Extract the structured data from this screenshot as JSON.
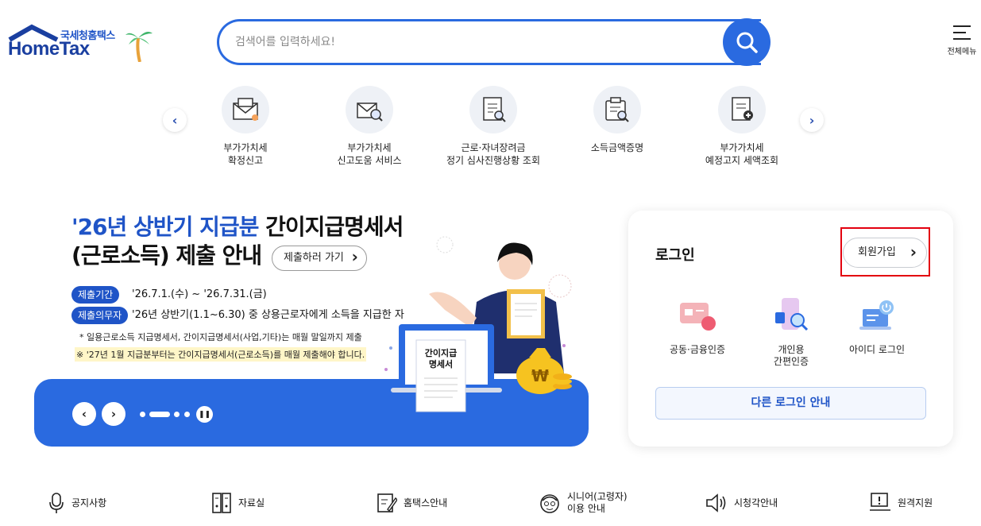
{
  "header": {
    "logo_kr": "국세청홈택스",
    "logo_en": "HomeTax",
    "search_placeholder": "검색어를 입력하세요!",
    "all_menu_label": "전체메뉴"
  },
  "quick_menu": [
    {
      "icon": "tax-envelope-icon",
      "line1": "부가가치세",
      "line2": "확정신고"
    },
    {
      "icon": "tax-search-icon",
      "line1": "부가가치세",
      "line2": "신고도움 서비스"
    },
    {
      "icon": "document-search-icon",
      "line1": "근로·자녀장려금",
      "line2": "정기 심사진행상황 조회"
    },
    {
      "icon": "certificate-search-icon",
      "line1": "소득금액증명",
      "line2": ""
    },
    {
      "icon": "document-add-icon",
      "line1": "부가가치세",
      "line2": "예정고지 세액조회"
    }
  ],
  "banner": {
    "title_hl": "'26년 상반기 지급분",
    "title_rest": " 간이지급명세서",
    "title_line2": "(근로소득) 제출 안내",
    "go_button": "제출하러 가기",
    "tag1": "제출기간",
    "tag1_text": "'26.7.1.(수) ~ '26.7.31.(금)",
    "tag2": "제출의무자",
    "tag2_text": "'26년 상반기(1.1~6.30) 중 상용근로자에게 소득을 지급한 자",
    "note1": "* 일용근로소득 지급명세서, 간이지급명세서(사업,기타)는 매월 말일까지 제출",
    "note2": "※ '27년 1월 지급분부터는 간이지급명세서(근로소득)를 매월 제출해야 합니다.",
    "doc_label": "간이지급명세서",
    "slide_count": 5,
    "active_slide": 2
  },
  "login": {
    "title": "로그인",
    "join_button": "회원가입",
    "options": [
      {
        "line1": "공동·금융인증",
        "line2": ""
      },
      {
        "line1": "개인용",
        "line2": "간편인증"
      },
      {
        "line1": "아이디 로그인",
        "line2": ""
      }
    ],
    "other_button": "다른 로그인 안내"
  },
  "bottom_menu": [
    {
      "icon": "microphone-icon",
      "line1": "공지사항",
      "line2": ""
    },
    {
      "icon": "binder-icon",
      "line1": "자료실",
      "line2": ""
    },
    {
      "icon": "edit-document-icon",
      "line1": "홈택스안내",
      "line2": ""
    },
    {
      "icon": "senior-icon",
      "line1": "시니어(고령자)",
      "line2": "이용 안내"
    },
    {
      "icon": "speaker-icon",
      "line1": "시청각안내",
      "line2": ""
    },
    {
      "icon": "remote-support-icon",
      "line1": "원격지원",
      "line2": ""
    }
  ],
  "colors": {
    "brand": "#2a6ae0",
    "brand_dark": "#1f54c7",
    "highlight_box": "#e3000f"
  }
}
